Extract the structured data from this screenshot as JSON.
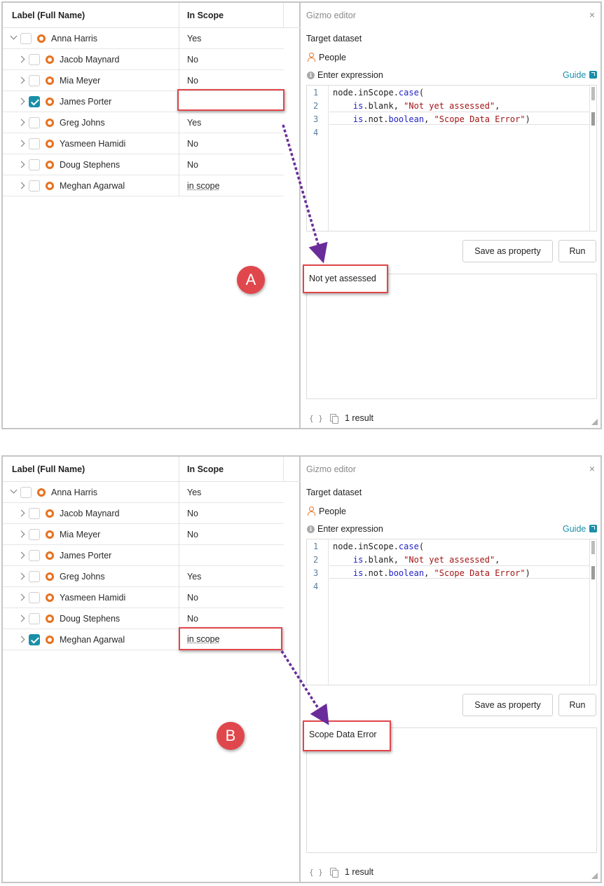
{
  "tree": {
    "col_label": "Label (Full Name)",
    "col_scope": "In Scope"
  },
  "panel_a": {
    "rows": [
      {
        "name": "Anna Harris",
        "scope": "Yes",
        "checked": false
      },
      {
        "name": "Jacob Maynard",
        "scope": "No",
        "checked": false
      },
      {
        "name": "Mia Meyer",
        "scope": "No",
        "checked": false
      },
      {
        "name": "James Porter",
        "scope": "",
        "checked": true
      },
      {
        "name": "Greg Johns",
        "scope": "Yes",
        "checked": false
      },
      {
        "name": "Yasmeen Hamidi",
        "scope": "No",
        "checked": false
      },
      {
        "name": "Doug Stephens",
        "scope": "No",
        "checked": false
      },
      {
        "name": "Meghan Agarwal",
        "scope": "in scope",
        "checked": false
      }
    ],
    "result": "Not yet assessed",
    "badge": "A"
  },
  "panel_b": {
    "rows": [
      {
        "name": "Anna Harris",
        "scope": "Yes",
        "checked": false
      },
      {
        "name": "Jacob Maynard",
        "scope": "No",
        "checked": false
      },
      {
        "name": "Mia Meyer",
        "scope": "No",
        "checked": false
      },
      {
        "name": "James Porter",
        "scope": "",
        "checked": false
      },
      {
        "name": "Greg Johns",
        "scope": "Yes",
        "checked": false
      },
      {
        "name": "Yasmeen Hamidi",
        "scope": "No",
        "checked": false
      },
      {
        "name": "Doug Stephens",
        "scope": "No",
        "checked": false
      },
      {
        "name": "Meghan Agarwal",
        "scope": "in scope",
        "checked": true
      }
    ],
    "result": "Scope Data Error",
    "badge": "B"
  },
  "editor": {
    "title": "Gizmo editor",
    "close": "×",
    "target_label": "Target dataset",
    "dataset": "People",
    "expr_label": "Enter expression",
    "info_glyph": "i",
    "guide": "Guide",
    "code_lines": [
      "1",
      "2",
      "3",
      "4"
    ],
    "code": {
      "l1_a": "node.inScope.",
      "l1_kw": "case",
      "l1_b": "(",
      "l2_indent": "    ",
      "l2_kw": "is",
      "l2_a": ".blank, ",
      "l2_str": "\"Not yet assessed\"",
      "l2_b": ",",
      "l3_indent": "    ",
      "l3_kw": "is",
      "l3_a": ".not.",
      "l3_kw2": "boolean",
      "l3_b": ", ",
      "l3_str": "\"Scope Data Error\"",
      "l3_c": ")"
    },
    "save_button": "Save as property",
    "run_button": "Run",
    "footer_code_icon": "{ }",
    "result_count": "1 result"
  },
  "colors": {
    "accent": "#1a8fa8",
    "node_icon": "#e8711f",
    "highlight_red": "#e0474c",
    "arrow_purple": "#6a2c9a"
  }
}
